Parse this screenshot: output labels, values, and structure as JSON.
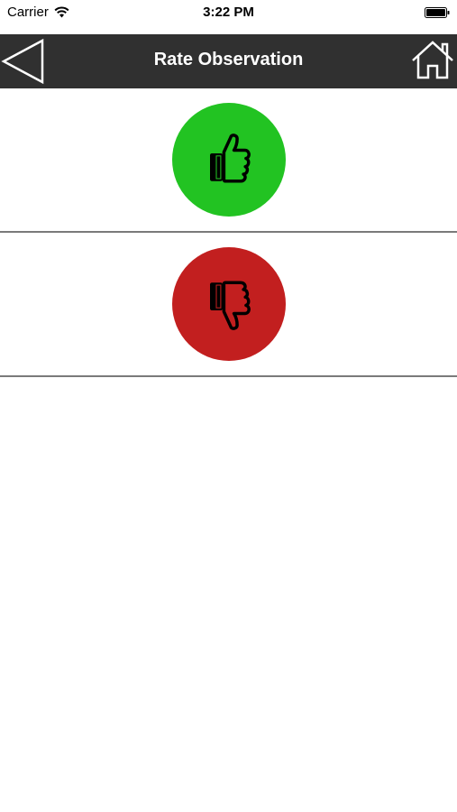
{
  "status_bar": {
    "carrier": "Carrier",
    "time": "3:22 PM"
  },
  "nav": {
    "title": "Rate Observation",
    "back_icon": "back-triangle-icon",
    "home_icon": "home-icon"
  },
  "ratings": [
    {
      "name": "thumbs-up",
      "icon": "thumbs-up-icon",
      "color": "#22c322"
    },
    {
      "name": "thumbs-down",
      "icon": "thumbs-down-icon",
      "color": "#c21f1f"
    }
  ],
  "colors": {
    "nav_background": "#303030",
    "divider": "#7a7a7a"
  }
}
